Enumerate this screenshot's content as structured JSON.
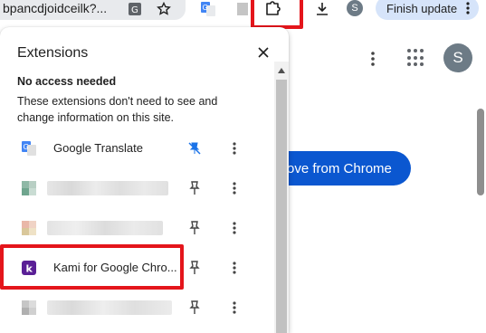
{
  "toolbar": {
    "url_fragment": "bpancdjoidceilk?...",
    "profile_initial": "S",
    "finish_update_label": "Finish update",
    "icons": [
      "translate-page-icon",
      "bookmark-star-icon",
      "extension-icon",
      "puzzle-extensions-icon",
      "download-icon",
      "kebab-menu-icon"
    ]
  },
  "page": {
    "remove_button_label": "ove from Chrome",
    "avatar_initial": "S"
  },
  "popup": {
    "title": "Extensions",
    "section_heading": "No access needed",
    "section_description": "These extensions don't need to see and change information on this site.",
    "extensions": [
      {
        "name": "Google Translate",
        "pinned": true,
        "icon": "google-translate-icon"
      },
      {
        "name": "",
        "pinned": false,
        "icon": "blurred-extension-icon"
      },
      {
        "name": "",
        "pinned": false,
        "icon": "blurred-extension-icon"
      },
      {
        "name": "Kami for Google Chro...",
        "pinned": false,
        "icon": "kami-icon",
        "icon_letter": "k"
      },
      {
        "name": "",
        "pinned": false,
        "icon": "blurred-extension-icon"
      }
    ]
  },
  "colors": {
    "highlight": "#e4151b",
    "primary_blue": "#0b57d0",
    "pinned_blue": "#1a73e8",
    "kami_purple": "#5a1f96"
  }
}
